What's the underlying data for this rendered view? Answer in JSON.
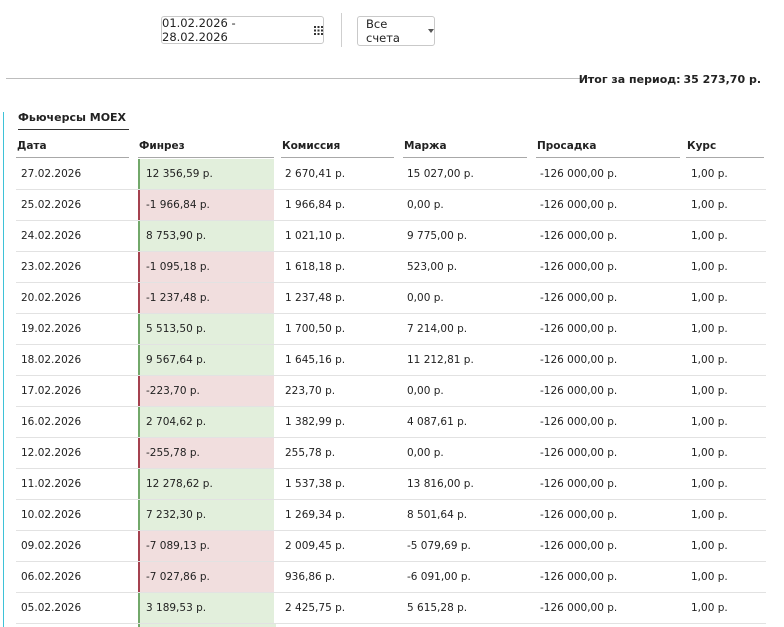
{
  "filters": {
    "date_range": "01.02.2026 - 28.02.2026",
    "account_select": "Все счета"
  },
  "summary": {
    "label": "Итог за период:",
    "value": "35 273,70 р."
  },
  "section": {
    "title": "Фьючерсы MOEX"
  },
  "table": {
    "headers": [
      "Дата",
      "Финрез",
      "Комиссия",
      "Маржа",
      "Просадка",
      "Курс"
    ],
    "rows": [
      [
        "27.02.2026",
        "12 356,59 р.",
        "2 670,41 р.",
        "15 027,00 р.",
        "-126 000,00 р.",
        "1,00 р."
      ],
      [
        "25.02.2026",
        "-1 966,84 р.",
        "1 966,84 р.",
        "0,00 р.",
        "-126 000,00 р.",
        "1,00 р."
      ],
      [
        "24.02.2026",
        "8 753,90 р.",
        "1 021,10 р.",
        "9 775,00 р.",
        "-126 000,00 р.",
        "1,00 р."
      ],
      [
        "23.02.2026",
        "-1 095,18 р.",
        "1 618,18 р.",
        "523,00 р.",
        "-126 000,00 р.",
        "1,00 р."
      ],
      [
        "20.02.2026",
        "-1 237,48 р.",
        "1 237,48 р.",
        "0,00 р.",
        "-126 000,00 р.",
        "1,00 р."
      ],
      [
        "19.02.2026",
        "5 513,50 р.",
        "1 700,50 р.",
        "7 214,00 р.",
        "-126 000,00 р.",
        "1,00 р."
      ],
      [
        "18.02.2026",
        "9 567,64 р.",
        "1 645,16 р.",
        "11 212,81 р.",
        "-126 000,00 р.",
        "1,00 р."
      ],
      [
        "17.02.2026",
        "-223,70 р.",
        "223,70 р.",
        "0,00 р.",
        "-126 000,00 р.",
        "1,00 р."
      ],
      [
        "16.02.2026",
        "2 704,62 р.",
        "1 382,99 р.",
        "4 087,61 р.",
        "-126 000,00 р.",
        "1,00 р."
      ],
      [
        "12.02.2026",
        "-255,78 р.",
        "255,78 р.",
        "0,00 р.",
        "-126 000,00 р.",
        "1,00 р."
      ],
      [
        "11.02.2026",
        "12 278,62 р.",
        "1 537,38 р.",
        "13 816,00 р.",
        "-126 000,00 р.",
        "1,00 р."
      ],
      [
        "10.02.2026",
        "7 232,30 р.",
        "1 269,34 р.",
        "8 501,64 р.",
        "-126 000,00 р.",
        "1,00 р."
      ],
      [
        "09.02.2026",
        "-7 089,13 р.",
        "2 009,45 р.",
        "-5 079,69 р.",
        "-126 000,00 р.",
        "1,00 р."
      ],
      [
        "06.02.2026",
        "-7 027,86 р.",
        "936,86 р.",
        "-6 091,00 р.",
        "-126 000,00 р.",
        "1,00 р."
      ],
      [
        "05.02.2026",
        "3 189,53 р.",
        "2 425,75 р.",
        "5 615,28 р.",
        "-126 000,00 р.",
        "1,00 р."
      ]
    ]
  },
  "colors": {
    "positive_bg": "#e2efdc",
    "negative_bg": "#f1dede",
    "accent": "#3ec2d8"
  },
  "icons": {
    "calendar": "calendar-icon",
    "dropdown": "chevron-down-icon"
  }
}
